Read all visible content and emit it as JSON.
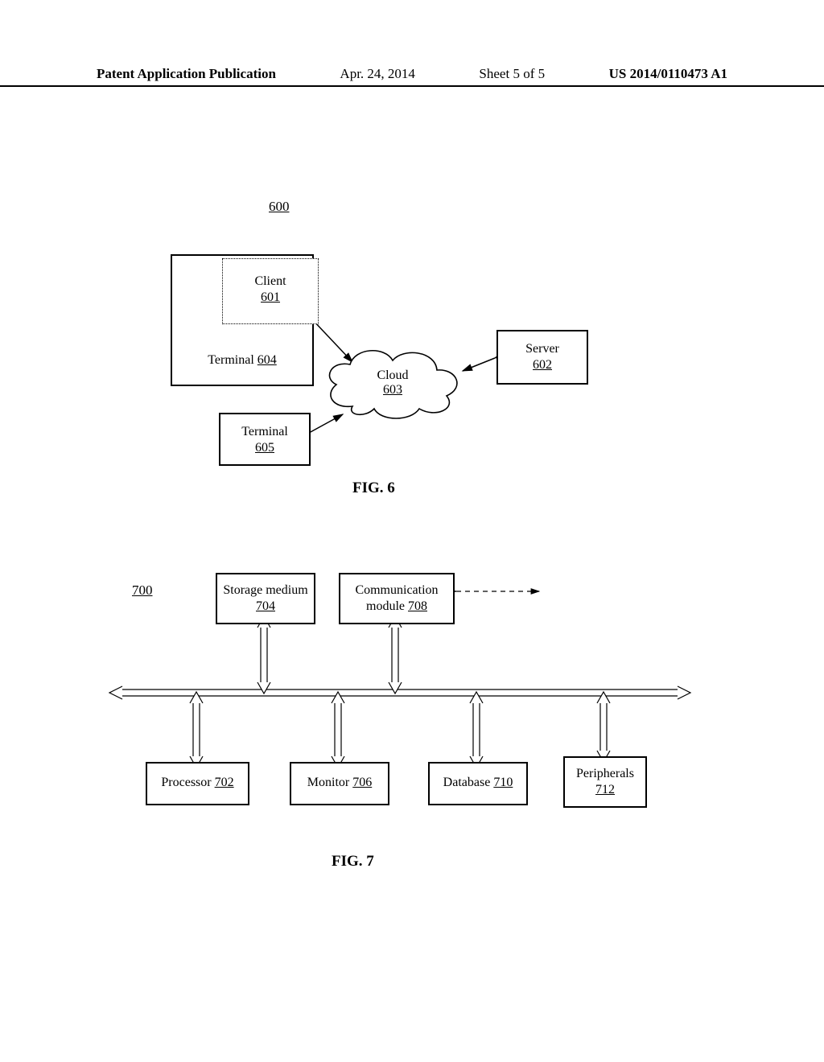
{
  "header": {
    "pub_type": "Patent Application Publication",
    "date": "Apr. 24, 2014",
    "sheet": "Sheet 5 of 5",
    "pub_number": "US 2014/0110473 A1"
  },
  "fig6": {
    "ref": "600",
    "label": "FIG. 6",
    "nodes": {
      "client": {
        "name": "Client",
        "num": "601"
      },
      "server": {
        "name": "Server",
        "num": "602"
      },
      "cloud": {
        "name": "Cloud",
        "num": "603"
      },
      "terminal_a": {
        "name": "Terminal",
        "num": "604"
      },
      "terminal_b": {
        "name": "Terminal",
        "num": "605"
      }
    }
  },
  "fig7": {
    "ref": "700",
    "label": "FIG. 7",
    "nodes": {
      "storage": {
        "name": "Storage medium",
        "num": "704"
      },
      "comm": {
        "name": "Communication module",
        "num": "708"
      },
      "processor": {
        "name": "Processor",
        "num": "702"
      },
      "monitor": {
        "name": "Monitor",
        "num": "706"
      },
      "database": {
        "name": "Database",
        "num": "710"
      },
      "peripherals": {
        "name": "Peripherals",
        "num": "712"
      }
    }
  }
}
